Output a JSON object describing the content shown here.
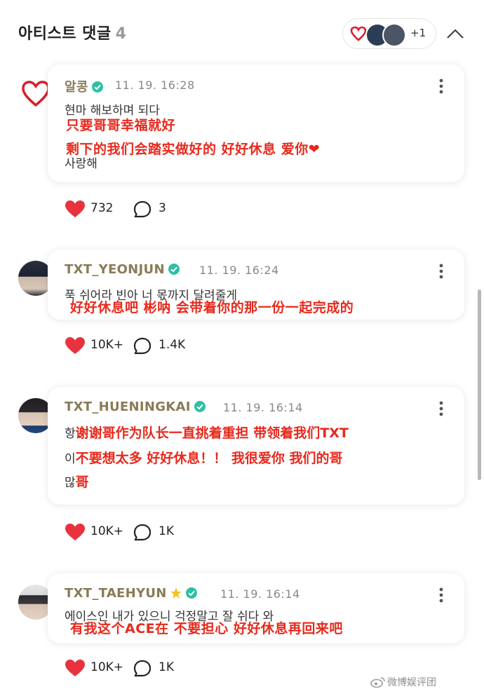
{
  "header": {
    "title": "아티스트 댓글",
    "count": "4",
    "more_count": "+1"
  },
  "colors": {
    "accent_red": "#e8291c",
    "heart": "#e8333f",
    "name": "#8a7b56",
    "verified": "#2fbfa6"
  },
  "icons": [
    "heart-avatar-icon",
    "verified-icon",
    "more-vertical-icon",
    "heart-icon",
    "comment-bubble-icon",
    "chevron-up-icon",
    "weibo-icon"
  ],
  "comments": [
    {
      "name": "알콩",
      "date": "11. 19. 16:28",
      "korean": [
        "현마 해보하며 되다",
        "사랑해"
      ],
      "chinese": [
        "只要哥哥幸福就好",
        "剩下的我们会踏实做好的 好好休息 爱你❤"
      ],
      "likes": "732",
      "replies": "3"
    },
    {
      "name": "TXT_YEONJUN",
      "date": "11. 19. 16:24",
      "korean": [
        "푹 쉬어라 빈아 너 몫까지 달려줄게"
      ],
      "chinese": [
        "好好休息吧 彬呐 会带着你的那一份一起完成的"
      ],
      "likes": "10K+",
      "replies": "1.4K"
    },
    {
      "name": "TXT_HUENINGKAI",
      "date": "11. 19. 16:14",
      "korean": [
        "항",
        "이",
        "많"
      ],
      "chinese": [
        "谢谢哥作为队长一直挑着重担 带领着我们TXT",
        "不要想太多 好好休息！！ 我很爱你 我们的哥",
        "哥"
      ],
      "likes": "10K+",
      "replies": "1K"
    },
    {
      "name": "TXT_TAEHYUN",
      "date": "11. 19. 16:14",
      "korean": [
        "에이스인 내가 있으니 걱정말고 잘 쉬다 와"
      ],
      "chinese": [
        "有我这个ACE在 不要担心 好好休息再回来吧"
      ],
      "likes": "10K+",
      "replies": "1K"
    }
  ],
  "watermark": "微博娱评团"
}
